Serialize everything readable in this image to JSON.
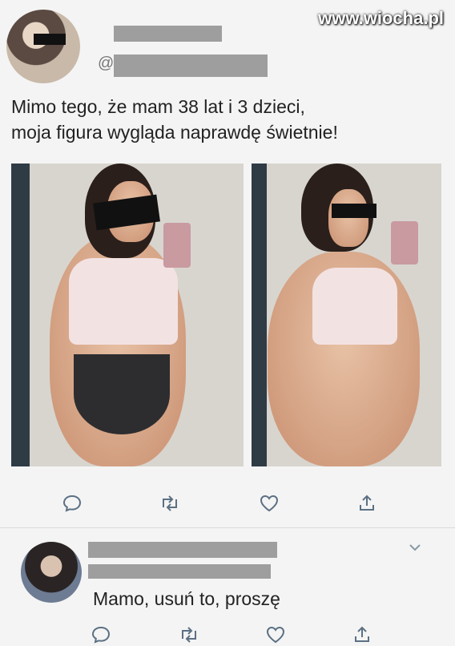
{
  "watermark": "www.wiocha.pl",
  "post": {
    "handle_prefix": "@",
    "text_line1": "Mimo tego, że mam 38 lat i 3 dzieci,",
    "text_line2": "moja figura wygląda naprawdę świetnie!",
    "actions": [
      "reply-icon",
      "retweet-icon",
      "like-icon",
      "share-icon"
    ]
  },
  "reply": {
    "text": "Mamo, usuń to, proszę",
    "actions": [
      "reply-icon",
      "retweet-icon",
      "like-icon",
      "share-icon"
    ]
  },
  "colors": {
    "action_icon": "#5b7083",
    "redaction": "#9e9e9e"
  }
}
